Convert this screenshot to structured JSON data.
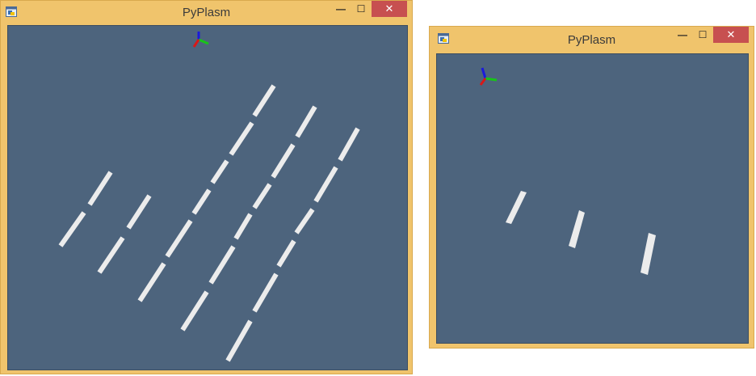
{
  "windows": [
    {
      "title": "PyPlasm",
      "controls": {
        "minimize": "—",
        "maximize": "☐",
        "close": "✕"
      },
      "icon": "python-window-icon",
      "viewport": {
        "axis_gizmo": "xyz-axes-icon",
        "object_count": 20
      }
    },
    {
      "title": "PyPlasm",
      "controls": {
        "minimize": "—",
        "maximize": "☐",
        "close": "✕"
      },
      "icon": "python-window-icon",
      "viewport": {
        "axis_gizmo": "xyz-axes-icon",
        "object_count": 3
      }
    }
  ],
  "colors": {
    "frame": "#f0c46c",
    "viewport_bg": "#4d647d",
    "close_button": "#c75050",
    "object": "#ececec"
  }
}
